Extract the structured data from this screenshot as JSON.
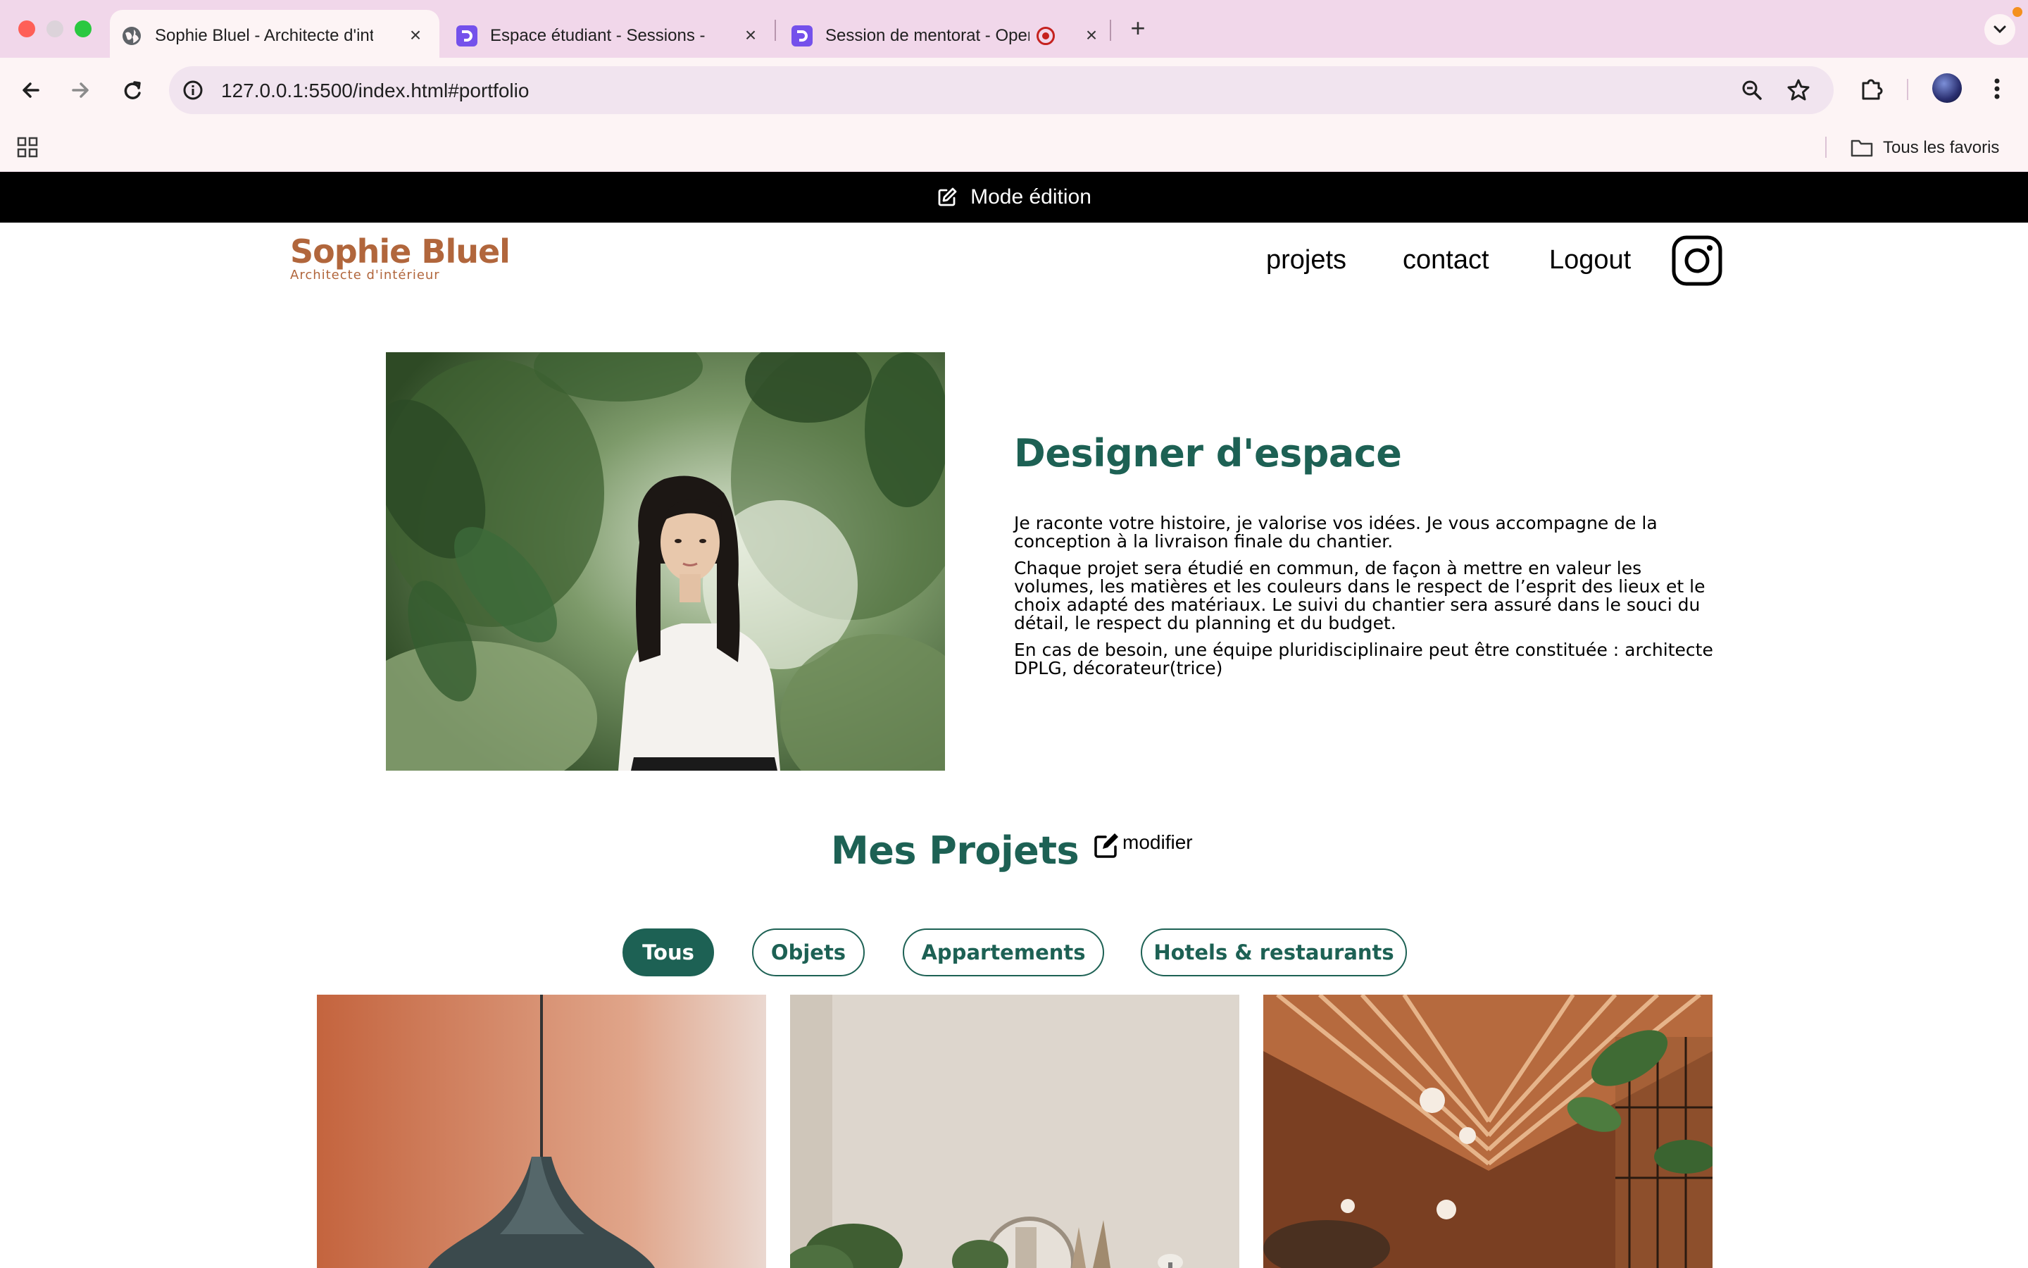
{
  "browser": {
    "tabs": [
      {
        "title": "Sophie Bluel - Architecte d'intérieur",
        "icon": "globe-icon"
      },
      {
        "title": "Espace étudiant - Sessions - OpenClassrooms",
        "icon": "openclassrooms-icon"
      },
      {
        "title": "Session de mentorat - OpenClassrooms",
        "icon": "openclassrooms-icon"
      }
    ],
    "url": "127.0.0.1:5500/index.html#portfolio",
    "bookmarks_folder": "Tous les favoris"
  },
  "edit_mode": {
    "label": "Mode édition"
  },
  "header": {
    "logo_name": "Sophie Bluel",
    "logo_subtitle": "Architecte d'intérieur",
    "nav": [
      "projets",
      "contact",
      "Logout"
    ]
  },
  "intro": {
    "title": "Designer d'espace",
    "paragraphs": [
      "Je raconte votre histoire, je valorise vos idées. Je vous accompagne de la conception à la livraison finale du chantier.",
      "Chaque projet sera étudié en commun, de façon à mettre en valeur les volumes, les matières et les couleurs dans le respect de l’esprit des lieux et le choix adapté des matériaux. Le suivi du chantier sera assuré dans le souci du détail, le respect du planning et du budget.",
      "En cas de besoin, une équipe pluridisciplinaire peut être constituée : architecte DPLG, décorateur(trice)"
    ]
  },
  "portfolio": {
    "title": "Mes Projets",
    "modify_label": "modifier",
    "filters": [
      "Tous",
      "Objets",
      "Appartements",
      "Hotels & restaurants"
    ],
    "active_filter": "Tous"
  },
  "colors": {
    "brand_green": "#1d6154",
    "logo_brown": "#b1663c",
    "tab_bar": "#f1d7ea",
    "toolbar": "#fdf4f5"
  }
}
